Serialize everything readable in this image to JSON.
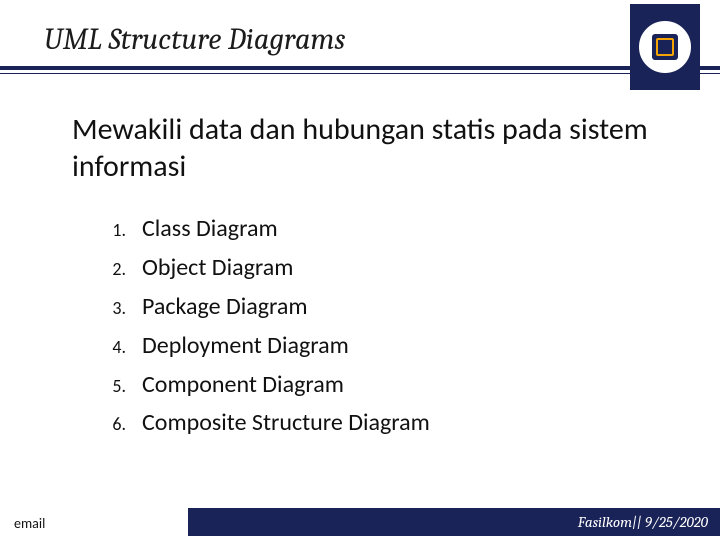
{
  "header": {
    "title": "UML Structure Diagrams"
  },
  "body": {
    "lead": "Mewakili data dan hubungan statis pada sistem informasi"
  },
  "list": {
    "items": [
      {
        "num": "1.",
        "text": "Class Diagram"
      },
      {
        "num": "2.",
        "text": "Object Diagram"
      },
      {
        "num": "3.",
        "text": "Package Diagram"
      },
      {
        "num": "4.",
        "text": "Deployment Diagram"
      },
      {
        "num": "5.",
        "text": "Component Diagram"
      },
      {
        "num": "6.",
        "text": "Composite Structure Diagram"
      }
    ]
  },
  "footer": {
    "email": "email",
    "bar": "Fasilkom|| 9/25/2020"
  }
}
